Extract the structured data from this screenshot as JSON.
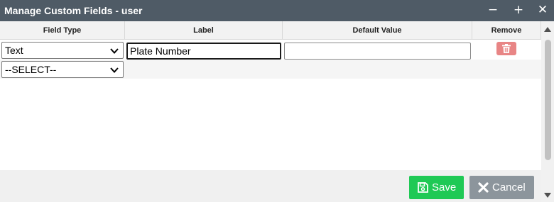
{
  "window": {
    "title": "Manage Custom Fields - user",
    "controls": [
      "minimize-icon",
      "plus-icon",
      "close-icon"
    ],
    "minimize_glyph": "−",
    "maximize_glyph": "+",
    "close_glyph": "✕"
  },
  "table": {
    "headers": {
      "field_type": "Field Type",
      "label": "Label",
      "default_value": "Default Value",
      "remove": "Remove"
    },
    "rows": [
      {
        "field_type": "Text",
        "label": "Plate Number",
        "default_value": "",
        "remove_icon": "trash-icon"
      },
      {
        "field_type": "--SELECT--"
      }
    ]
  },
  "footer": {
    "save_label": "Save",
    "cancel_label": "Cancel",
    "save_icon": "floppy-disk-icon",
    "cancel_icon": "x-icon"
  },
  "colors": {
    "titlebar": "#4f5b66",
    "save": "#1fc955",
    "cancel": "#8c959c",
    "delete": "#e88585"
  }
}
